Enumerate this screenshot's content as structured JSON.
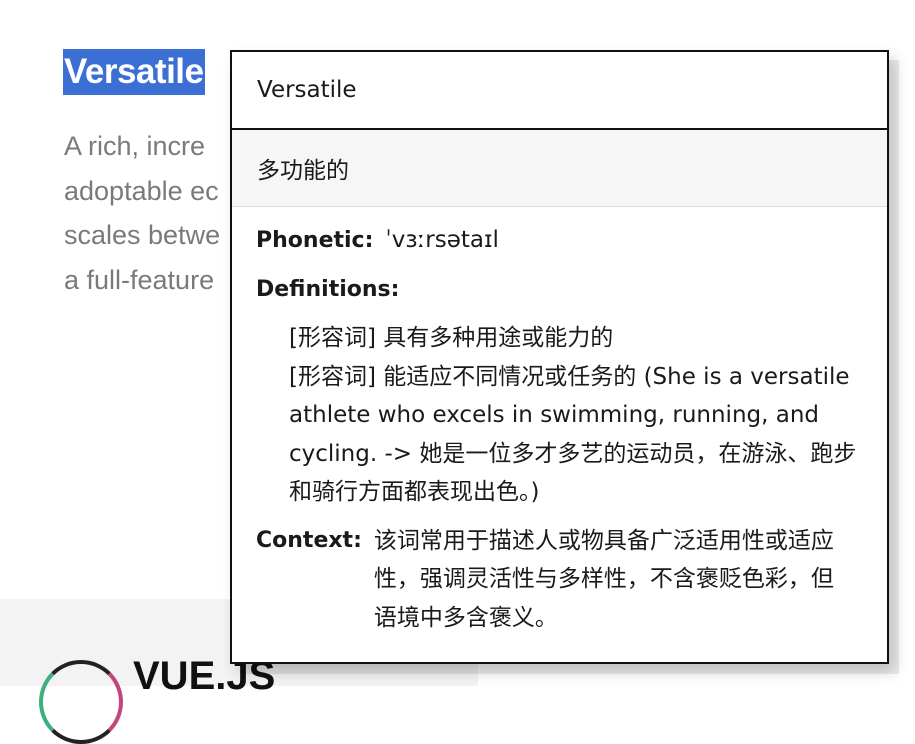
{
  "background": {
    "heading": "Versatile",
    "paragraph_lines": [
      "A rich, incre",
      "adoptable ec",
      "scales betwe",
      "a full-feature"
    ],
    "logo_text": "VUE.JS"
  },
  "popup": {
    "word": "Versatile",
    "translation": "多功能的",
    "phonetic_label": "Phonetic:",
    "phonetic": "ˈvɜːrsətaɪl",
    "definitions_label": "Definitions:",
    "definitions": [
      "[形容词] 具有多种用途或能力的",
      "[形容词] 能适应不同情况或任务的 (She is a versatile athlete who excels in swimming, running, and cycling. -> 她是一位多才多艺的运动员，在游泳、跑步和骑行方面都表现出色。)"
    ],
    "context_label": "Context:",
    "context": "该词常用于描述人或物具备广泛适用性或适应性，强调灵活性与多样性，不含褒贬色彩，但语境中多含褒义。"
  },
  "colors": {
    "selection": "#3b6fd4",
    "paragraph_text": "#7a7a7a",
    "popup_border": "#111111",
    "translation_bg": "#f6f6f6"
  }
}
